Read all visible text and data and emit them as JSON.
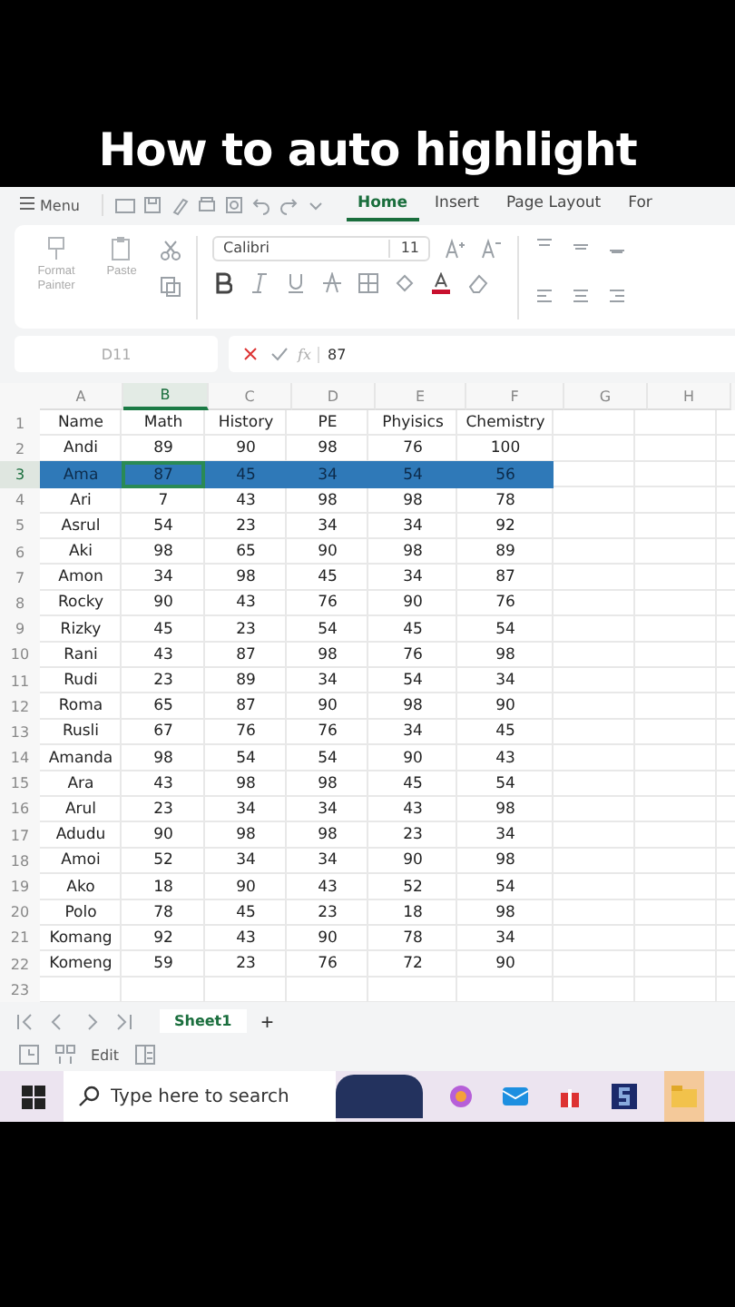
{
  "caption": "How to auto highlight",
  "menu_bar": {
    "menu": "Menu",
    "tabs": [
      {
        "label": "Home",
        "selected": true
      },
      {
        "label": "Insert",
        "selected": false
      },
      {
        "label": "Page Layout",
        "selected": false
      },
      {
        "label": "For",
        "selected": false
      }
    ]
  },
  "ribbon": {
    "format_painter": "Format Painter",
    "paste": "Paste",
    "font": "Calibri",
    "font_size": "11"
  },
  "formula_bar": {
    "name_box": "D11",
    "fx": "fx",
    "formula": "87"
  },
  "columns": [
    {
      "label": "A",
      "selected": false
    },
    {
      "label": "B",
      "selected": true
    },
    {
      "label": "C",
      "selected": false
    },
    {
      "label": "D",
      "selected": false
    },
    {
      "label": "E",
      "selected": false
    },
    {
      "label": "F",
      "selected": false
    },
    {
      "label": "G",
      "selected": false
    },
    {
      "label": "H",
      "selected": false
    }
  ],
  "rows": [
    {
      "number": "1",
      "selected": false,
      "cells": [
        "Name",
        "Math",
        "History",
        "PE",
        "Phyisics",
        "Chemistry"
      ]
    },
    {
      "number": "2",
      "selected": false,
      "cells": [
        "Andi",
        "89",
        "90",
        "98",
        "76",
        "100"
      ]
    },
    {
      "number": "3",
      "selected": true,
      "cells": [
        "Ama",
        "87",
        "45",
        "34",
        "54",
        "56"
      ]
    },
    {
      "number": "4",
      "selected": false,
      "cells": [
        "Ari",
        "7",
        "43",
        "98",
        "98",
        "78"
      ]
    },
    {
      "number": "5",
      "selected": false,
      "cells": [
        "Asrul",
        "54",
        "23",
        "34",
        "34",
        "92"
      ]
    },
    {
      "number": "6",
      "selected": false,
      "cells": [
        "Aki",
        "98",
        "65",
        "90",
        "98",
        "89"
      ]
    },
    {
      "number": "7",
      "selected": false,
      "cells": [
        "Amon",
        "34",
        "98",
        "45",
        "34",
        "87"
      ]
    },
    {
      "number": "8",
      "selected": false,
      "cells": [
        "Rocky",
        "90",
        "43",
        "76",
        "90",
        "76"
      ]
    },
    {
      "number": "9",
      "selected": false,
      "cells": [
        "Rizky",
        "45",
        "23",
        "54",
        "45",
        "54"
      ]
    },
    {
      "number": "10",
      "selected": false,
      "cells": [
        "Rani",
        "43",
        "87",
        "98",
        "76",
        "98"
      ]
    },
    {
      "number": "11",
      "selected": false,
      "cells": [
        "Rudi",
        "23",
        "89",
        "34",
        "54",
        "34"
      ]
    },
    {
      "number": "12",
      "selected": false,
      "cells": [
        "Roma",
        "65",
        "87",
        "90",
        "98",
        "90"
      ]
    },
    {
      "number": "13",
      "selected": false,
      "cells": [
        "Rusli",
        "67",
        "76",
        "76",
        "34",
        "45"
      ]
    },
    {
      "number": "14",
      "selected": false,
      "cells": [
        "Amanda",
        "98",
        "54",
        "54",
        "90",
        "43"
      ]
    },
    {
      "number": "15",
      "selected": false,
      "cells": [
        "Ara",
        "43",
        "98",
        "98",
        "45",
        "54"
      ]
    },
    {
      "number": "16",
      "selected": false,
      "cells": [
        "Arul",
        "23",
        "34",
        "34",
        "43",
        "98"
      ]
    },
    {
      "number": "17",
      "selected": false,
      "cells": [
        "Adudu",
        "90",
        "98",
        "98",
        "23",
        "34"
      ]
    },
    {
      "number": "18",
      "selected": false,
      "cells": [
        "Amoi",
        "52",
        "34",
        "34",
        "90",
        "98"
      ]
    },
    {
      "number": "19",
      "selected": false,
      "cells": [
        "Ako",
        "18",
        "90",
        "43",
        "52",
        "54"
      ]
    },
    {
      "number": "20",
      "selected": false,
      "cells": [
        "Polo",
        "78",
        "45",
        "23",
        "18",
        "98"
      ]
    },
    {
      "number": "21",
      "selected": false,
      "cells": [
        "Komang",
        "92",
        "43",
        "90",
        "78",
        "34"
      ]
    },
    {
      "number": "22",
      "selected": false,
      "cells": [
        "Komeng",
        "59",
        "23",
        "76",
        "72",
        "90"
      ]
    },
    {
      "number": "23",
      "selected": false,
      "cells": []
    }
  ],
  "sheet_tabs": [
    {
      "label": "Sheet1",
      "selected": true
    }
  ],
  "add_sheet": "+",
  "status_bar": {
    "mode": "Edit"
  },
  "taskbar": {
    "search_placeholder": "Type here to search"
  }
}
